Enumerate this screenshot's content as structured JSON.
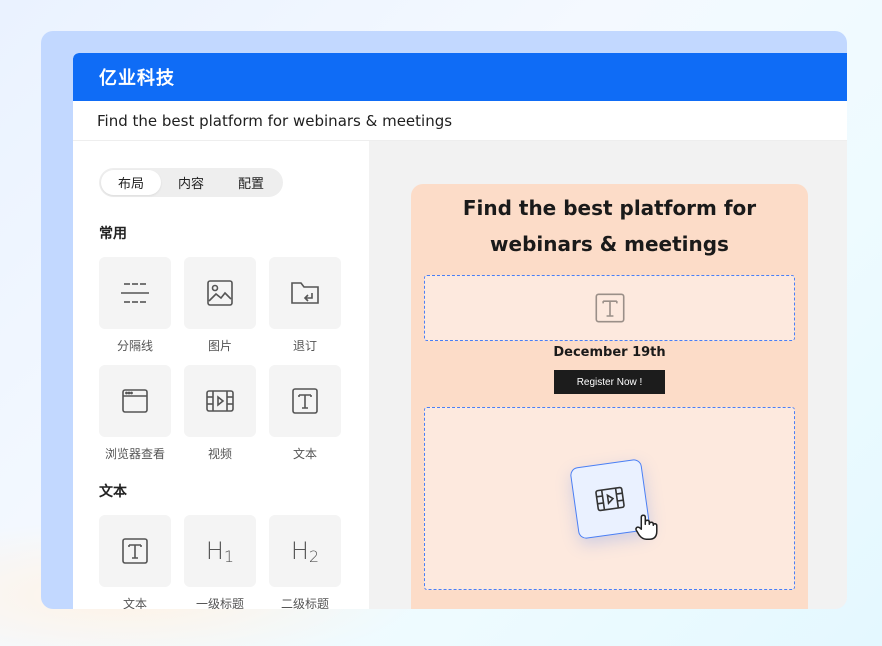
{
  "app": {
    "title": "亿业科技"
  },
  "urlbar": {
    "text": "Find the best platform for webinars & meetings"
  },
  "tabs": [
    {
      "label": "布局",
      "active": true
    },
    {
      "label": "内容",
      "active": false
    },
    {
      "label": "配置",
      "active": false
    }
  ],
  "sections": {
    "common": {
      "title": "常用",
      "items": [
        {
          "label": "分隔线",
          "icon": "divider-icon"
        },
        {
          "label": "图片",
          "icon": "image-icon"
        },
        {
          "label": "退订",
          "icon": "unsubscribe-folder-icon"
        },
        {
          "label": "浏览器查看",
          "icon": "browser-window-icon"
        },
        {
          "label": "视频",
          "icon": "video-icon"
        },
        {
          "label": "文本",
          "icon": "text-icon"
        }
      ]
    },
    "text": {
      "title": "文本",
      "items": [
        {
          "label": "文本",
          "icon": "text-icon"
        },
        {
          "label": "一级标题",
          "icon": "heading-1-icon"
        },
        {
          "label": "二级标题",
          "icon": "heading-2-icon"
        }
      ]
    }
  },
  "canvas": {
    "title": "Find the best platform for webinars & meetings",
    "date": "December 19th",
    "register_label": "Register Now !"
  },
  "colors": {
    "brand": "#0f6cf6",
    "canvas_bg": "#fcdcc8",
    "dash": "#4a7ff5",
    "button": "#1c1c1c"
  }
}
